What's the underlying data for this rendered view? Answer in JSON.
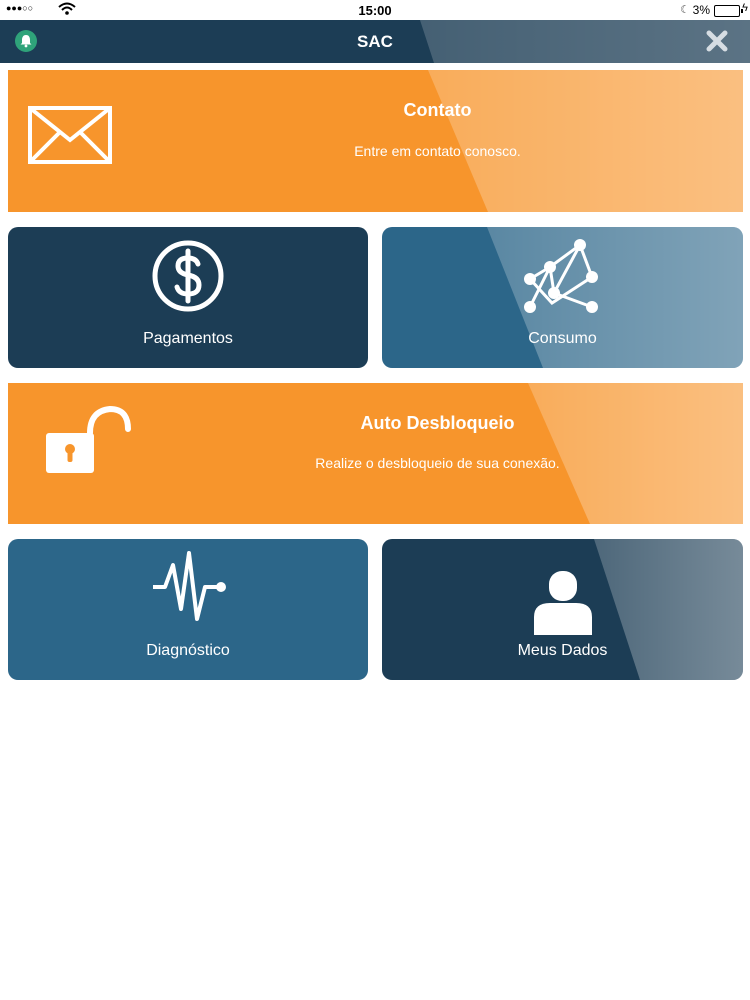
{
  "status_bar": {
    "signal": "●●●○○",
    "time": "15:00",
    "battery": "3%"
  },
  "navbar": {
    "title": "SAC",
    "left_icon": "bell-icon",
    "right_icon": "close-icon"
  },
  "tiles": {
    "contato": {
      "title": "Contato",
      "subtitle": "Entre em contato conosco.",
      "icon": "envelope-icon"
    },
    "pagamentos": {
      "label": "Pagamentos",
      "icon": "dollar-icon"
    },
    "consumo": {
      "label": "Consumo",
      "icon": "graph-icon"
    },
    "desbloqueio": {
      "title": "Auto Desbloqueio",
      "subtitle": "Realize o desbloqueio de sua conexão.",
      "icon": "unlock-icon"
    },
    "diagnostico": {
      "label": "Diagnóstico",
      "icon": "pulse-icon"
    },
    "meus_dados": {
      "label": "Meus Dados",
      "icon": "user-icon"
    }
  },
  "colors": {
    "navy": "#1c3d55",
    "blue": "#2c6689",
    "orange": "#f7952c",
    "bell_green": "#2fa37a"
  }
}
